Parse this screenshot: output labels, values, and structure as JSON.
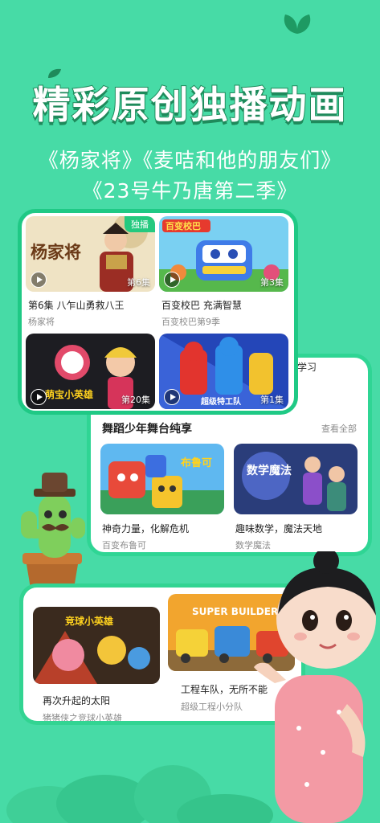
{
  "headline": "精彩原创独播动画",
  "subtitle_line1": "《杨家将》《麦咭和他的朋友们》",
  "subtitle_line2": "《23号牛乃唐第二季》",
  "top_card": {
    "items": [
      {
        "title": "第6集 八乍山勇救八王",
        "subtitle": "杨家将",
        "badge": "独播",
        "episode": "第6集",
        "art_text": "杨家将"
      },
      {
        "title": "百变校巴 充满智慧",
        "subtitle": "百变校巴第9季",
        "episode": "第3集",
        "art_text": "百变校巴"
      },
      {
        "title": "",
        "subtitle": "",
        "episode": "第20集",
        "art_text": "萌宝小英雄"
      },
      {
        "title": "",
        "subtitle": "",
        "episode": "第1集",
        "art_text": "超级特工队"
      }
    ]
  },
  "mid_card": {
    "cut_text": "学习",
    "section_title": "舞蹈少年舞台纯享",
    "see_all": "查看全部",
    "items": [
      {
        "title": "神奇力量，化解危机",
        "subtitle": "百变布鲁可",
        "art_text": "布鲁可"
      },
      {
        "title": "趣味数学，魔法天地",
        "subtitle": "数学魔法",
        "art_text": "数学魔法"
      }
    ]
  },
  "bottom_card": {
    "items": [
      {
        "title": "再次升起的太阳",
        "subtitle": "猪猪侠之竞球小英雄",
        "art_text": "竞球小英雄"
      },
      {
        "title": "工程车队，无所不能",
        "subtitle": "超级工程小分队",
        "art_text": "SUPER BUILDERS"
      }
    ]
  },
  "colors": {
    "background": "#47dba6",
    "accent": "#1fc985",
    "badge": "#24c97f"
  }
}
